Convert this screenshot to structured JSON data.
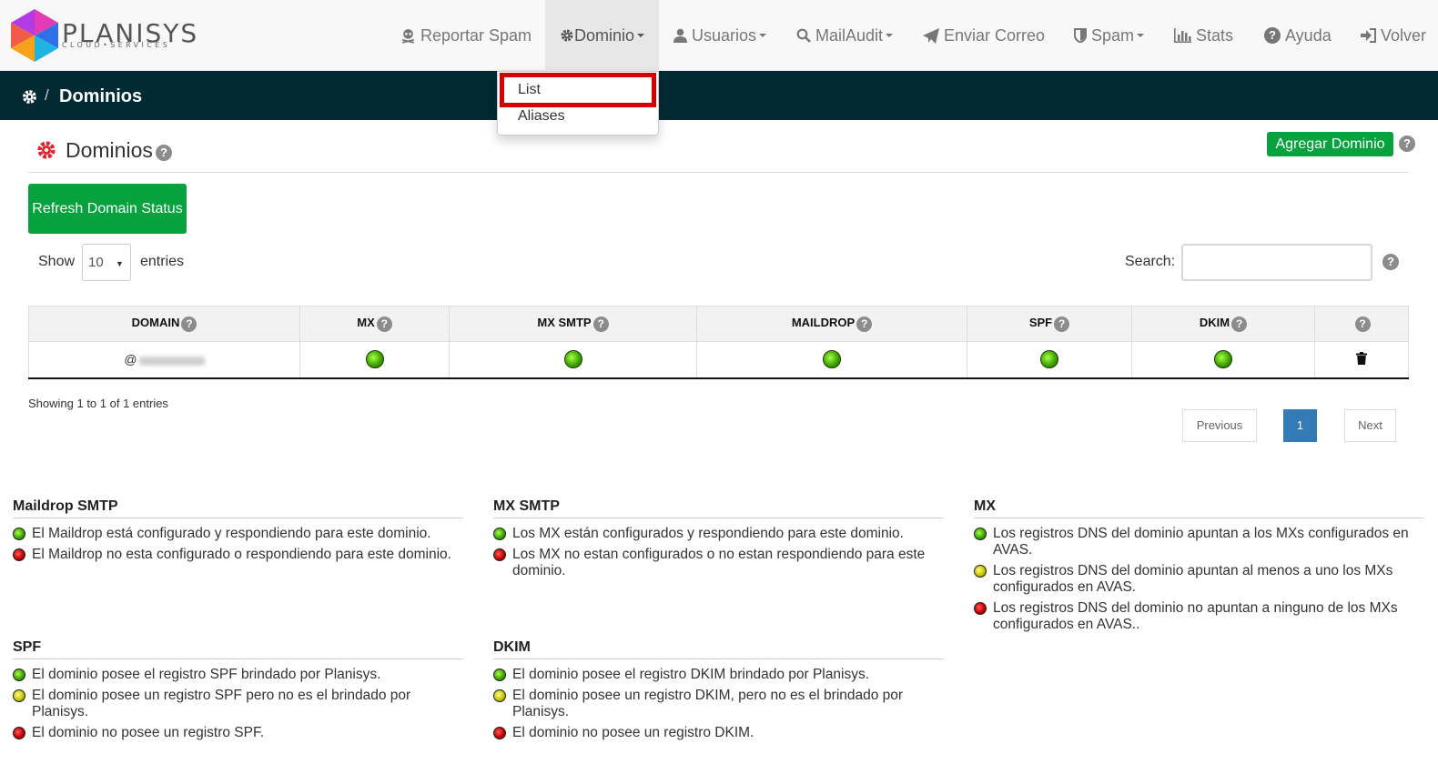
{
  "brand": {
    "name": "PLANISYS",
    "tagline": "CLOUD•SERVICES"
  },
  "nav": [
    {
      "label": "Reportar Spam",
      "icon": "skull-icon",
      "dropdown": false
    },
    {
      "label": "Dominio",
      "icon": "gear-icon",
      "dropdown": true,
      "active": true
    },
    {
      "label": "Usuarios",
      "icon": "user-icon",
      "dropdown": true
    },
    {
      "label": "MailAudit",
      "icon": "search-icon",
      "dropdown": true
    },
    {
      "label": "Enviar Correo",
      "icon": "paper-plane-icon",
      "dropdown": false
    },
    {
      "label": "Spam",
      "icon": "shield-icon",
      "dropdown": true
    },
    {
      "label": "Stats",
      "icon": "bar-chart-icon",
      "dropdown": false
    },
    {
      "label": "Ayuda",
      "icon": "question-circle-icon",
      "dropdown": false
    },
    {
      "label": "Volver",
      "icon": "sign-in-icon",
      "dropdown": false
    }
  ],
  "dropdown": {
    "items": [
      "List",
      "Aliases"
    ],
    "highlighted": "List"
  },
  "breadcrumb": {
    "separator": "/",
    "title": "Dominios"
  },
  "page": {
    "title": "Dominios",
    "help": "?",
    "add_button": "Agregar Dominio",
    "refresh_button": "Refresh Domain Status"
  },
  "table_controls": {
    "show_label": "Show",
    "page_size": "10",
    "entries_label": "entries",
    "search_label": "Search:",
    "search_value": ""
  },
  "table": {
    "columns": [
      "DOMAIN",
      "MX",
      "MX SMTP",
      "MAILDROP",
      "SPF",
      "DKIM",
      ""
    ],
    "rows": [
      {
        "domain_prefix": "@",
        "mx": "green",
        "mx_smtp": "green",
        "maildrop": "green",
        "spf": "green",
        "dkim": "green",
        "action": "trash-icon"
      }
    ]
  },
  "pagination": {
    "info": "Showing 1 to 1 of 1 entries",
    "previous": "Previous",
    "current": "1",
    "next": "Next"
  },
  "legends": {
    "maildrop_smtp": {
      "title": "Maildrop SMTP",
      "items": [
        {
          "status": "green",
          "text": "El Maildrop está configurado y respondiendo para este dominio."
        },
        {
          "status": "red",
          "text": "El Maildrop no esta configurado o respondiendo para este dominio."
        }
      ]
    },
    "mx_smtp": {
      "title": "MX SMTP",
      "items": [
        {
          "status": "green",
          "text": "Los MX están configurados y respondiendo para este dominio."
        },
        {
          "status": "red",
          "text": "Los MX no estan configurados o no estan respondiendo para este dominio."
        }
      ]
    },
    "mx": {
      "title": "MX",
      "items": [
        {
          "status": "green",
          "text": "Los registros DNS del dominio apuntan a los MXs configurados en AVAS."
        },
        {
          "status": "yellow",
          "text": "Los registros DNS del dominio apuntan al menos a uno los MXs configurados en AVAS."
        },
        {
          "status": "red",
          "text": "Los registros DNS del dominio no apuntan a ninguno de los MXs configurados en AVAS.."
        }
      ]
    },
    "spf": {
      "title": "SPF",
      "items": [
        {
          "status": "green",
          "text": "El dominio posee el registro SPF brindado por Planisys."
        },
        {
          "status": "yellow",
          "text": "El dominio posee un registro SPF pero no es el brindado por Planisys."
        },
        {
          "status": "red",
          "text": "El dominio no posee un registro SPF."
        }
      ]
    },
    "dkim": {
      "title": "DKIM",
      "items": [
        {
          "status": "green",
          "text": "El dominio posee el registro DKIM brindado por Planisys."
        },
        {
          "status": "yellow",
          "text": "El dominio posee un registro DKIM, pero no es el brindado por Planisys."
        },
        {
          "status": "red",
          "text": "El dominio no posee un registro DKIM."
        }
      ]
    }
  },
  "colors": {
    "navbar_bg": "#f8f8f8",
    "breadcrumb_bg": "#022a33",
    "button_green": "#05a23d",
    "pagination_active": "#337ab7",
    "highlight_red": "#d60000",
    "title_gear": "#e0242c"
  }
}
